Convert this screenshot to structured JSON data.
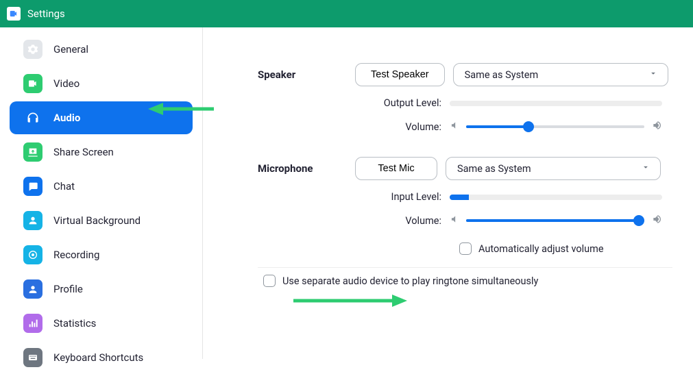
{
  "window": {
    "title": "Settings"
  },
  "sidebar": {
    "items": [
      {
        "label": "General",
        "icon": "gear",
        "color": "#e3e6ea"
      },
      {
        "label": "Video",
        "icon": "video",
        "color": "#2ecc71"
      },
      {
        "label": "Audio",
        "icon": "headphones",
        "color": "#0e72ed",
        "active": true
      },
      {
        "label": "Share Screen",
        "icon": "share",
        "color": "#2ecc71"
      },
      {
        "label": "Chat",
        "icon": "chat",
        "color": "#0e72ed"
      },
      {
        "label": "Virtual Background",
        "icon": "person",
        "color": "#15b3e6"
      },
      {
        "label": "Recording",
        "icon": "record",
        "color": "#15b3e6"
      },
      {
        "label": "Profile",
        "icon": "profile",
        "color": "#2a6fe0"
      },
      {
        "label": "Statistics",
        "icon": "stats",
        "color": "#b16cea"
      },
      {
        "label": "Keyboard Shortcuts",
        "icon": "keyboard",
        "color": "#6e7680"
      }
    ]
  },
  "speaker": {
    "section": "Speaker",
    "test_button": "Test Speaker",
    "device": "Same as System",
    "output_label": "Output Level:",
    "output_level_pct": 0,
    "volume_label": "Volume:",
    "volume_pct": 35
  },
  "microphone": {
    "section": "Microphone",
    "test_button": "Test Mic",
    "device": "Same as System",
    "input_label": "Input Level:",
    "input_level_pct": 9,
    "volume_label": "Volume:",
    "volume_pct": 97,
    "auto_adjust_label": "Automatically adjust volume",
    "auto_adjust_checked": false
  },
  "separate_device": {
    "label": "Use separate audio device to play ringtone simultaneously",
    "checked": false
  }
}
